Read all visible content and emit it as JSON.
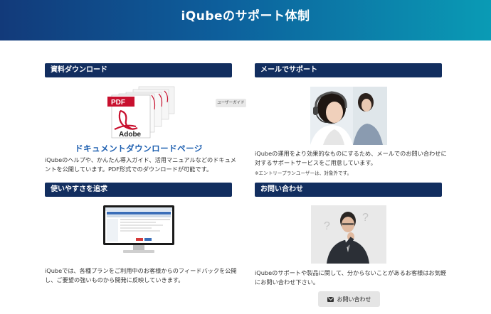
{
  "hero": {
    "title": "iQubeのサポート体制"
  },
  "sections": {
    "download": {
      "header": "資料ダウンロード",
      "pdf_label": "PDF",
      "adobe_label": "Adobe",
      "tooltip": "ユーザーガイド",
      "link": "ドキュメントダウンロードページ",
      "desc_line1": "iQubeのヘルプや、かんたん導入ガイド、活用マニュアルなどのドキュメ",
      "desc_line2": "ントを公開しています。PDF形式でのダウンロードが可能です。"
    },
    "mail": {
      "header": "メールでサポート",
      "desc_line1": "iQubeの運用をより効果的なものにするため、メールでのお問い合わせに",
      "desc_line2": "対するサポートサービスをご用意しています。",
      "note": "※エントリープランユーザーは、対象外です。"
    },
    "usability": {
      "header": "使いやすさを追求",
      "desc_line1": "iQubeでは、各種プランをご利用中のお客様からのフィードバックを公開",
      "desc_line2": "し、ご要望の強いものから開発に反映していきます。"
    },
    "inquiry": {
      "header": "お問い合わせ",
      "desc_line1": "iQubeのサポートや製品に関して、分からないことがあるお客様はお気軽",
      "desc_line2": "にお問い合わせ下さい。",
      "button": "お問い合わせ"
    }
  },
  "colors": {
    "header_bg": "#122e5f",
    "link": "#1d5fb0",
    "hero_start": "#123a7a",
    "hero_end": "#0a9bb5"
  }
}
